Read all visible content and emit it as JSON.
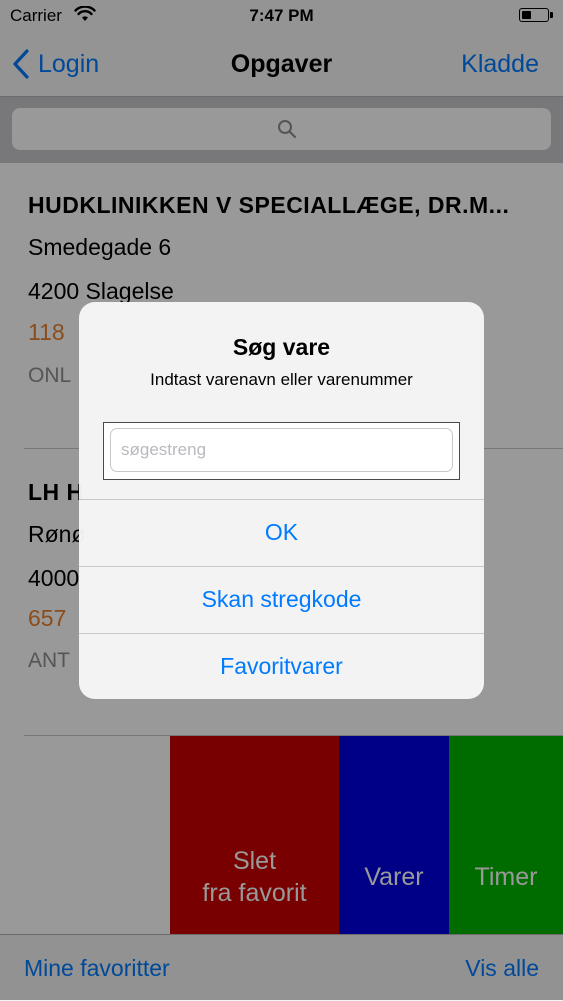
{
  "status_bar": {
    "carrier": "Carrier",
    "time": "7:47 PM"
  },
  "nav": {
    "back_label": "Login",
    "title": "Opgaver",
    "right_label": "Kladde"
  },
  "search": {
    "icon": "search-icon"
  },
  "list": {
    "items": [
      {
        "title": "HUDKLINIKKEN V SPECIALLÆGE, DR.M...",
        "street": "Smedegade 6",
        "city": "4200  Slagelse",
        "number": "118",
        "tag": "ONL"
      },
      {
        "title": "LH H",
        "street": "Rønø",
        "city": "4000",
        "number": "657",
        "tag": "ANT"
      }
    ]
  },
  "swipe_actions": {
    "delete_line1": "Slet",
    "delete_line2": "fra favorit",
    "varer": "Varer",
    "timer": "Timer"
  },
  "toolbar": {
    "left": "Mine favoritter",
    "right": "Vis alle"
  },
  "alert": {
    "title": "Søg vare",
    "message": "Indtast varenavn eller varenummer",
    "input_placeholder": "søgestreng",
    "ok": "OK",
    "scan": "Skan stregkode",
    "favorites": "Favoritvarer"
  },
  "colors": {
    "accent": "#007aff",
    "delete": "#c80000",
    "varer": "#0000e0",
    "timer": "#00b400",
    "number": "#e8802e"
  }
}
